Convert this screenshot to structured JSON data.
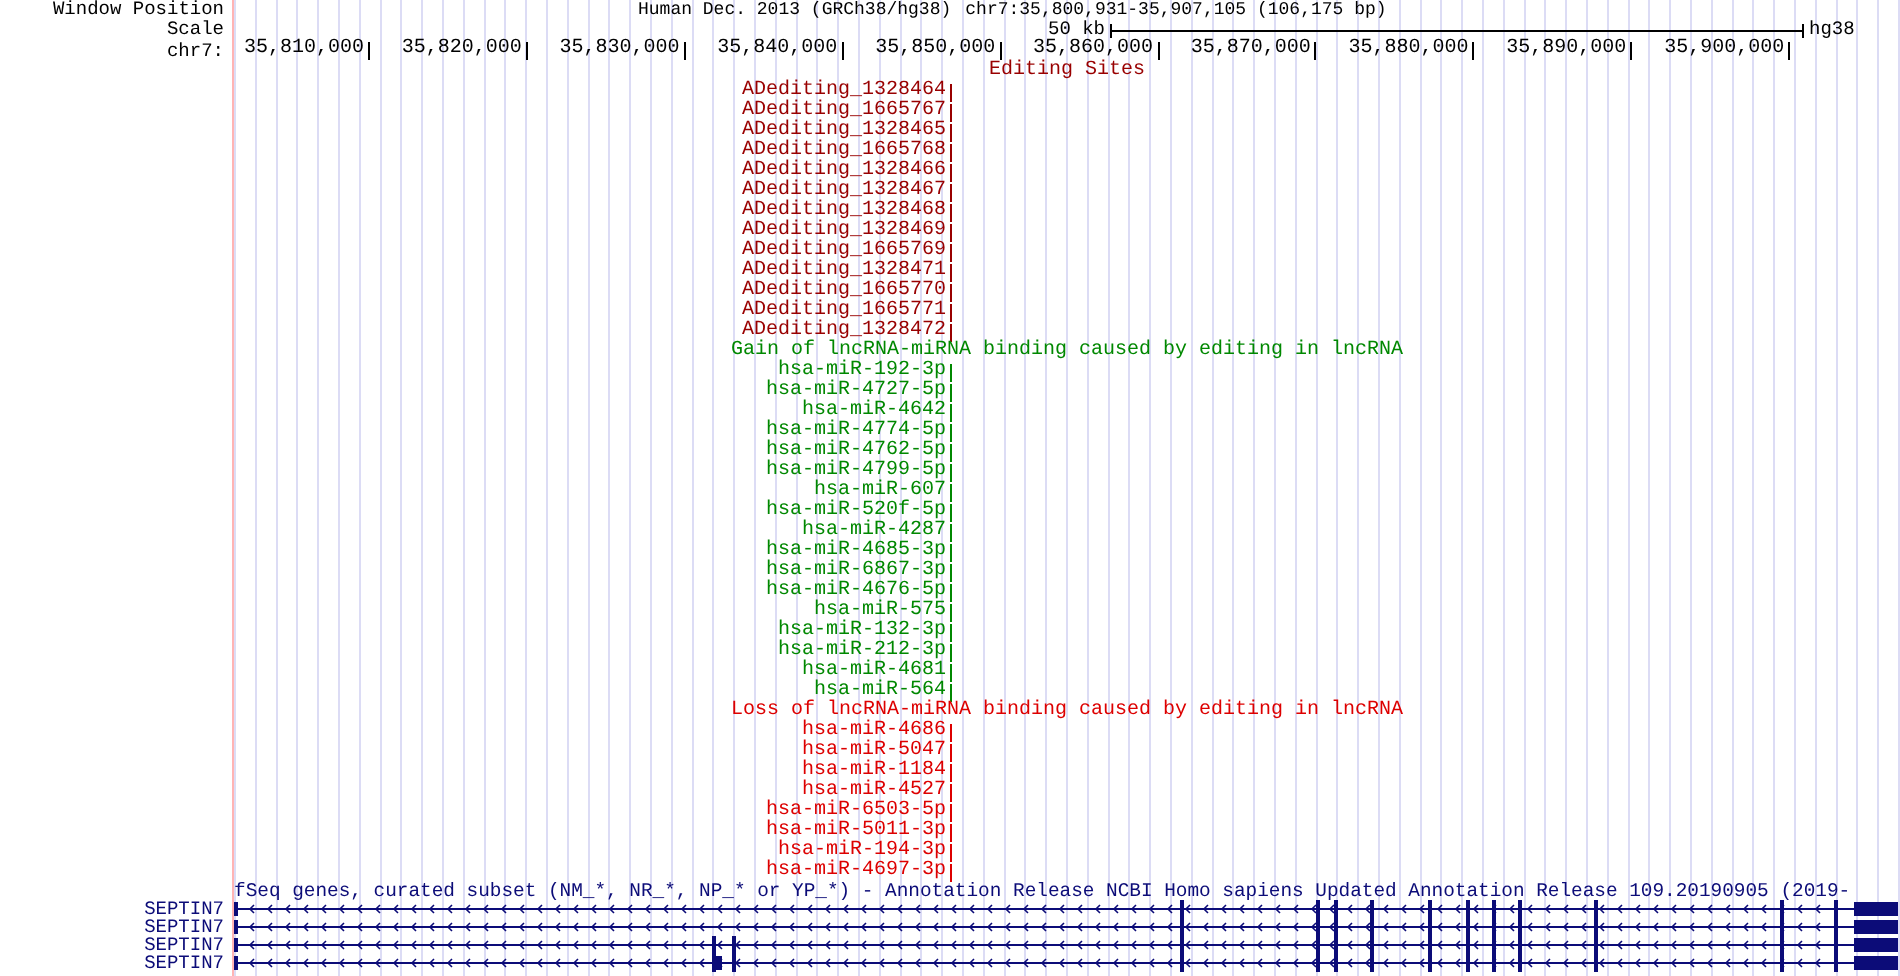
{
  "position": {
    "label": "Window Position",
    "assembly": "Human Dec. 2013 (GRCh38/hg38)",
    "range": "chr7:35,800,931-35,907,105 (106,175 bp)"
  },
  "scale": {
    "label": "Scale",
    "length": "50 kb",
    "assembly": "hg38"
  },
  "ruler": {
    "label": "chr7:",
    "ticks": [
      "35,810,000",
      "35,820,000",
      "35,830,000",
      "35,840,000",
      "35,850,000",
      "35,860,000",
      "35,870,000",
      "35,880,000",
      "35,890,000",
      "35,900,000"
    ]
  },
  "tracks": [
    {
      "title": "Editing Sites",
      "color": "#990000",
      "items": [
        "ADediting_1328464",
        "ADediting_1665767",
        "ADediting_1328465",
        "ADediting_1665768",
        "ADediting_1328466",
        "ADediting_1328467",
        "ADediting_1328468",
        "ADediting_1328469",
        "ADediting_1665769",
        "ADediting_1328471",
        "ADediting_1665770",
        "ADediting_1665771",
        "ADediting_1328472"
      ]
    },
    {
      "title": "Gain of lncRNA-miRNA binding caused by editing in lncRNA",
      "color": "#008800",
      "items": [
        "hsa-miR-192-3p",
        "hsa-miR-4727-5p",
        "hsa-miR-4642",
        "hsa-miR-4774-5p",
        "hsa-miR-4762-5p",
        "hsa-miR-4799-5p",
        "hsa-miR-607",
        "hsa-miR-520f-5p",
        "hsa-miR-4287",
        "hsa-miR-4685-3p",
        "hsa-miR-6867-3p",
        "hsa-miR-4676-5p",
        "hsa-miR-575",
        "hsa-miR-132-3p",
        "hsa-miR-212-3p",
        "hsa-miR-4681",
        "hsa-miR-564"
      ]
    },
    {
      "title": "Loss of lncRNA-miRNA binding caused by editing in lncRNA",
      "color": "#dd0000",
      "items": [
        "hsa-miR-4686",
        "hsa-miR-5047",
        "hsa-miR-1184",
        "hsa-miR-4527",
        "hsa-miR-6503-5p",
        "hsa-miR-5011-3p",
        "hsa-miR-194-3p",
        "hsa-miR-4697-3p"
      ]
    }
  ],
  "genes": {
    "title": "fSeq genes, curated subset (NM_*, NR_*, NP_* or YP_*) - Annotation Release NCBI Homo sapiens Updated Annotation Release 109.20190905 (2019-",
    "rows": [
      "SEPTIN7",
      "SEPTIN7",
      "SEPTIN7",
      "SEPTIN7"
    ]
  }
}
